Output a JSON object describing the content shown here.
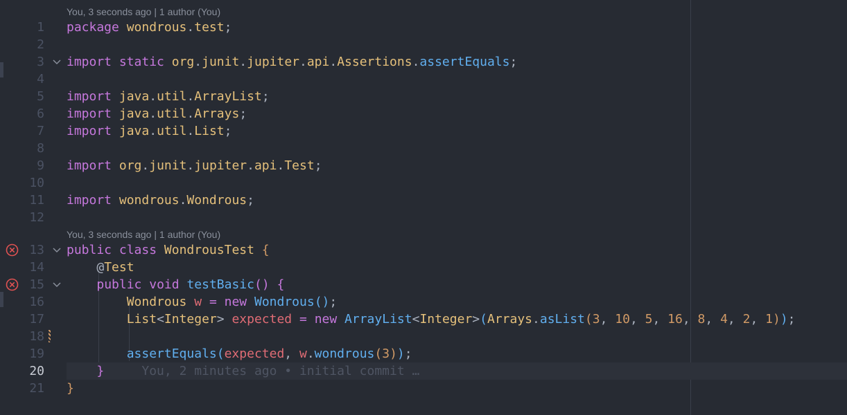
{
  "code_lens": [
    "You, 3 seconds ago | 1 author (You)",
    "You, 3 seconds ago | 1 author (You)"
  ],
  "lines": [
    {
      "n": "1",
      "tokens": [
        [
          "kw",
          "package"
        ],
        [
          "pn",
          " "
        ],
        [
          "ty",
          "wondrous"
        ],
        [
          "pn",
          "."
        ],
        [
          "ty",
          "test"
        ],
        [
          "pn",
          ";"
        ]
      ]
    },
    {
      "n": "2",
      "tokens": []
    },
    {
      "n": "3",
      "fold": true,
      "tokens": [
        [
          "kw",
          "import"
        ],
        [
          "pn",
          " "
        ],
        [
          "kw",
          "static"
        ],
        [
          "pn",
          " "
        ],
        [
          "ty",
          "org"
        ],
        [
          "pn",
          "."
        ],
        [
          "ty",
          "junit"
        ],
        [
          "pn",
          "."
        ],
        [
          "ty",
          "jupiter"
        ],
        [
          "pn",
          "."
        ],
        [
          "ty",
          "api"
        ],
        [
          "pn",
          "."
        ],
        [
          "ty",
          "Assertions"
        ],
        [
          "pn",
          "."
        ],
        [
          "fn",
          "assertEquals"
        ],
        [
          "pn",
          ";"
        ]
      ]
    },
    {
      "n": "4",
      "tokens": []
    },
    {
      "n": "5",
      "tokens": [
        [
          "kw",
          "import"
        ],
        [
          "pn",
          " "
        ],
        [
          "ty",
          "java"
        ],
        [
          "pn",
          "."
        ],
        [
          "ty",
          "util"
        ],
        [
          "pn",
          "."
        ],
        [
          "ty",
          "ArrayList"
        ],
        [
          "pn",
          ";"
        ]
      ]
    },
    {
      "n": "6",
      "tokens": [
        [
          "kw",
          "import"
        ],
        [
          "pn",
          " "
        ],
        [
          "ty",
          "java"
        ],
        [
          "pn",
          "."
        ],
        [
          "ty",
          "util"
        ],
        [
          "pn",
          "."
        ],
        [
          "ty",
          "Arrays"
        ],
        [
          "pn",
          ";"
        ]
      ]
    },
    {
      "n": "7",
      "tokens": [
        [
          "kw",
          "import"
        ],
        [
          "pn",
          " "
        ],
        [
          "ty",
          "java"
        ],
        [
          "pn",
          "."
        ],
        [
          "ty",
          "util"
        ],
        [
          "pn",
          "."
        ],
        [
          "ty",
          "List"
        ],
        [
          "pn",
          ";"
        ]
      ]
    },
    {
      "n": "8",
      "tokens": []
    },
    {
      "n": "9",
      "tokens": [
        [
          "kw",
          "import"
        ],
        [
          "pn",
          " "
        ],
        [
          "ty",
          "org"
        ],
        [
          "pn",
          "."
        ],
        [
          "ty",
          "junit"
        ],
        [
          "pn",
          "."
        ],
        [
          "ty",
          "jupiter"
        ],
        [
          "pn",
          "."
        ],
        [
          "ty",
          "api"
        ],
        [
          "pn",
          "."
        ],
        [
          "ty",
          "Test"
        ],
        [
          "pn",
          ";"
        ]
      ]
    },
    {
      "n": "10",
      "tokens": []
    },
    {
      "n": "11",
      "tokens": [
        [
          "kw",
          "import"
        ],
        [
          "pn",
          " "
        ],
        [
          "ty",
          "wondrous"
        ],
        [
          "pn",
          "."
        ],
        [
          "ty",
          "Wondrous"
        ],
        [
          "pn",
          ";"
        ]
      ]
    },
    {
      "n": "12",
      "tokens": []
    },
    {
      "n": "13",
      "fold": true,
      "error": true,
      "tokens": [
        [
          "kw",
          "public"
        ],
        [
          "pn",
          " "
        ],
        [
          "kw",
          "class"
        ],
        [
          "pn",
          " "
        ],
        [
          "ty",
          "WondrousTest"
        ],
        [
          "pn",
          " "
        ],
        [
          "br1",
          "{"
        ]
      ]
    },
    {
      "n": "14",
      "tokens": [
        [
          "pn",
          "    "
        ],
        [
          "pn",
          "@"
        ],
        [
          "ty",
          "Test"
        ]
      ]
    },
    {
      "n": "15",
      "fold": true,
      "error": true,
      "tokens": [
        [
          "pn",
          "    "
        ],
        [
          "kw",
          "public"
        ],
        [
          "pn",
          " "
        ],
        [
          "kw",
          "void"
        ],
        [
          "pn",
          " "
        ],
        [
          "fn",
          "testBasic"
        ],
        [
          "br2",
          "()"
        ],
        [
          "pn",
          " "
        ],
        [
          "br2",
          "{"
        ]
      ]
    },
    {
      "n": "16",
      "tokens": [
        [
          "pn",
          "        "
        ],
        [
          "ty",
          "Wondrous"
        ],
        [
          "pn",
          " "
        ],
        [
          "var",
          "w"
        ],
        [
          "pn",
          " "
        ],
        [
          "kw",
          "="
        ],
        [
          "pn",
          " "
        ],
        [
          "kw",
          "new"
        ],
        [
          "pn",
          " "
        ],
        [
          "fn",
          "Wondrous"
        ],
        [
          "br3",
          "()"
        ],
        [
          "pn",
          ";"
        ]
      ]
    },
    {
      "n": "17",
      "tokens": [
        [
          "pn",
          "        "
        ],
        [
          "ty",
          "List"
        ],
        [
          "pn",
          "<"
        ],
        [
          "ty",
          "Integer"
        ],
        [
          "pn",
          "> "
        ],
        [
          "var",
          "expected"
        ],
        [
          "pn",
          " "
        ],
        [
          "kw",
          "="
        ],
        [
          "pn",
          " "
        ],
        [
          "kw",
          "new"
        ],
        [
          "pn",
          " "
        ],
        [
          "fn",
          "ArrayList"
        ],
        [
          "pn",
          "<"
        ],
        [
          "ty",
          "Integer"
        ],
        [
          "pn",
          ">"
        ],
        [
          "br3",
          "("
        ],
        [
          "ty",
          "Arrays"
        ],
        [
          "pn",
          "."
        ],
        [
          "fn",
          "asList"
        ],
        [
          "br1",
          "("
        ],
        [
          "num",
          "3"
        ],
        [
          "pn",
          ", "
        ],
        [
          "num",
          "10"
        ],
        [
          "pn",
          ", "
        ],
        [
          "num",
          "5"
        ],
        [
          "pn",
          ", "
        ],
        [
          "num",
          "16"
        ],
        [
          "pn",
          ", "
        ],
        [
          "num",
          "8"
        ],
        [
          "pn",
          ", "
        ],
        [
          "num",
          "4"
        ],
        [
          "pn",
          ", "
        ],
        [
          "num",
          "2"
        ],
        [
          "pn",
          ", "
        ],
        [
          "num",
          "1"
        ],
        [
          "br1",
          ")"
        ],
        [
          "br3",
          ")"
        ],
        [
          "pn",
          ";"
        ]
      ]
    },
    {
      "n": "18",
      "modified": true,
      "tokens": []
    },
    {
      "n": "19",
      "tokens": [
        [
          "pn",
          "        "
        ],
        [
          "fn",
          "assertEquals"
        ],
        [
          "br3",
          "("
        ],
        [
          "var",
          "expected"
        ],
        [
          "pn",
          ", "
        ],
        [
          "var",
          "w"
        ],
        [
          "pn",
          "."
        ],
        [
          "fn",
          "wondrous"
        ],
        [
          "br1",
          "("
        ],
        [
          "num",
          "3"
        ],
        [
          "br1",
          ")"
        ],
        [
          "br3",
          ")"
        ],
        [
          "pn",
          ";"
        ]
      ]
    },
    {
      "n": "20",
      "current": true,
      "tokens": [
        [
          "pn",
          "    "
        ],
        [
          "br2",
          "}"
        ],
        [
          "ghost",
          "     You, 2 minutes ago • initial commit …"
        ]
      ]
    },
    {
      "n": "21",
      "tokens": [
        [
          "br1",
          "}"
        ]
      ]
    }
  ]
}
